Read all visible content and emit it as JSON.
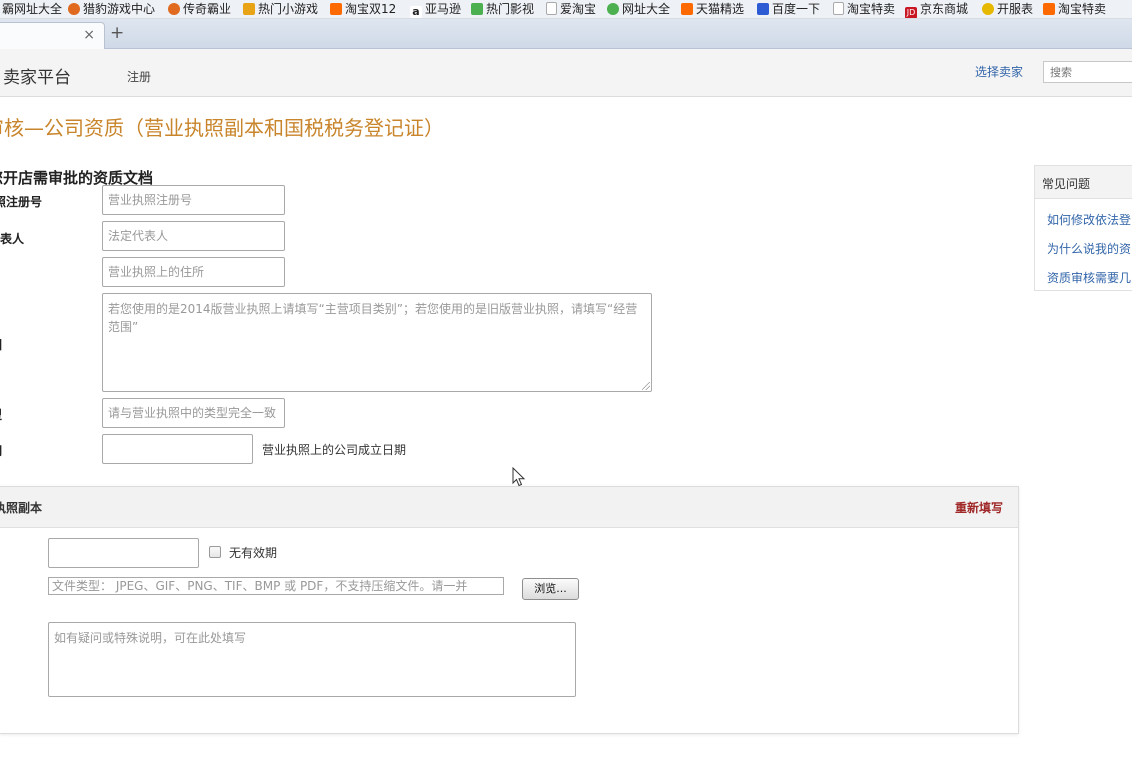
{
  "browser": {
    "bookmarks": [
      {
        "label": "霸网址大全",
        "color": "#d9412b",
        "icon": "site-icon"
      },
      {
        "label": "猎豹游戏中心",
        "color": "#e06a1f",
        "icon": "leopard-icon"
      },
      {
        "label": "传奇霸业",
        "color": "#e06a1f",
        "icon": "game-icon"
      },
      {
        "label": "热门小游戏",
        "color": "#e8a317",
        "icon": "game-icon"
      },
      {
        "label": "淘宝双12",
        "color": "#ff6a00",
        "icon": "taobao-icon"
      },
      {
        "label": "亚马逊",
        "color": "#222222",
        "icon": "amazon-icon"
      },
      {
        "label": "热门影视",
        "color": "#4caf50",
        "icon": "video-icon"
      },
      {
        "label": "爱淘宝",
        "color": "#bbbbbb",
        "icon": "page-icon"
      },
      {
        "label": "网址大全",
        "color": "#4caf50",
        "icon": "site-icon"
      },
      {
        "label": "天猫精选",
        "color": "#ff6a00",
        "icon": "tmall-icon"
      },
      {
        "label": "百度一下",
        "color": "#2d5bd3",
        "icon": "baidu-paw-icon"
      },
      {
        "label": "淘宝特卖",
        "color": "#bbbbbb",
        "icon": "page-icon"
      },
      {
        "label": "京东商城",
        "color": "#c91623",
        "icon": "jd-icon"
      },
      {
        "label": "开服表",
        "color": "#e6b800",
        "icon": "game-icon"
      },
      {
        "label": "淘宝特卖",
        "color": "#ff6a00",
        "icon": "taobao-icon"
      }
    ],
    "tab_close": "×",
    "new_tab": "+"
  },
  "header": {
    "brand": "卖家平台",
    "nav_register": "注册",
    "choose_seller": "选择卖家",
    "search_placeholder": "搜索"
  },
  "page": {
    "title": "审核—公司资质（营业执照副本和国税税务登记证）",
    "section_title": "您开店需审批的资质文档"
  },
  "form": {
    "fields": [
      {
        "label": "照注册号",
        "placeholder": "营业执照注册号"
      },
      {
        "label": "代表人",
        "placeholder": "法定代表人"
      },
      {
        "label": "",
        "placeholder": "营业执照上的住所"
      },
      {
        "label": "围",
        "placeholder": "若您使用的是2014版营业执照上请填写“主营项目类别”；若您使用的是旧版营业执照，请填写“经营范围”"
      },
      {
        "label": "型",
        "placeholder": "请与营业执照中的类型完全一致"
      },
      {
        "label": "期",
        "placeholder": "",
        "hint": "营业执照上的公司成立日期"
      }
    ]
  },
  "faq": {
    "title": "常见问题",
    "links": [
      "如何修改依法登",
      "为什么说我的资",
      "资质审核需要几"
    ]
  },
  "license_panel": {
    "title": "执照副本",
    "refill": "重新填写",
    "no_expiry_label": "无有效期",
    "file_placeholder": "文件类型： JPEG、GIF、PNG、TIF、BMP 或 PDF，不支持压缩文件。请一并",
    "browse": "浏览...",
    "note_placeholder": "如有疑问或特殊说明，可在此处填写"
  }
}
